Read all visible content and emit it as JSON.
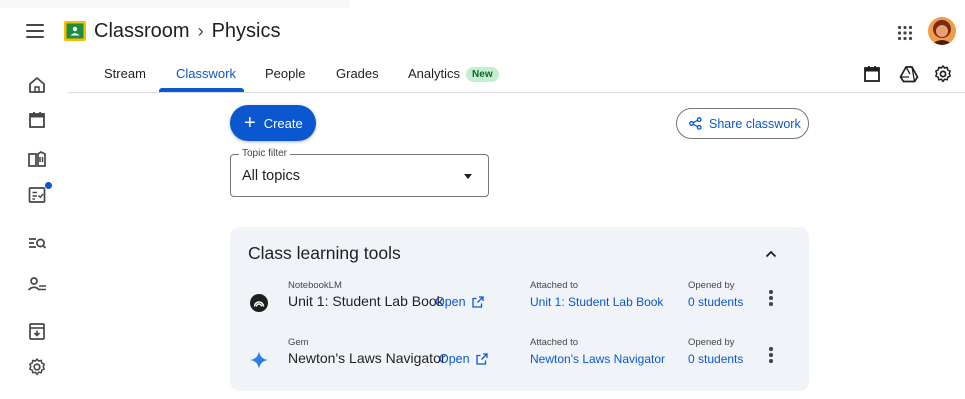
{
  "header": {
    "app_name": "Classroom",
    "separator": "›",
    "class_name": "Physics",
    "icons": [
      "menu-icon",
      "classroom-logo",
      "apps-grid-icon",
      "user-avatar"
    ]
  },
  "rail": {
    "items": [
      {
        "name": "home-icon"
      },
      {
        "name": "calendar-icon"
      },
      {
        "name": "enrolled-classes-icon"
      },
      {
        "name": "to-do-icon",
        "has_dot": true
      },
      {
        "name": "to-review-icon"
      },
      {
        "name": "people-icon"
      },
      {
        "name": "archived-classes-icon"
      },
      {
        "name": "settings-icon"
      }
    ]
  },
  "tabs": [
    {
      "label": "Stream"
    },
    {
      "label": "Classwork",
      "active": true
    },
    {
      "label": "People"
    },
    {
      "label": "Grades"
    },
    {
      "label": "Analytics",
      "badge": "New"
    }
  ],
  "toolbar_icons": [
    "calendar-icon",
    "google-drive-icon",
    "class-settings-icon"
  ],
  "classwork": {
    "create_label": "Create",
    "share_label": "Share classwork",
    "topic_filter": {
      "label": "Topic filter",
      "value": "All topics"
    }
  },
  "tools_card": {
    "title": "Class learning tools",
    "rows": [
      {
        "kind": "NotebookLM",
        "name": "Unit 1: Student Lab Book",
        "open_label": "Open",
        "attached_label": "Attached to",
        "attached_value": "Unit 1: Student Lab Book",
        "opened_label": "Opened by",
        "opened_value": "0 students",
        "icon": "notebooklm-icon"
      },
      {
        "kind": "Gem",
        "name": "Newton's Laws Navigator",
        "open_label": "Open",
        "attached_label": "Attached to",
        "attached_value": "Newton's Laws Navigator",
        "opened_label": "Opened by",
        "opened_value": "0 students",
        "icon": "gem-sparkle-icon"
      }
    ]
  },
  "colors": {
    "accent": "#0b57d0",
    "new_badge_bg": "#c4eed0",
    "new_badge_text": "#0d652d",
    "card_bg": "#f0f4f9",
    "logo_green": "#1e8e3e",
    "logo_yellow": "#fbbc04"
  }
}
